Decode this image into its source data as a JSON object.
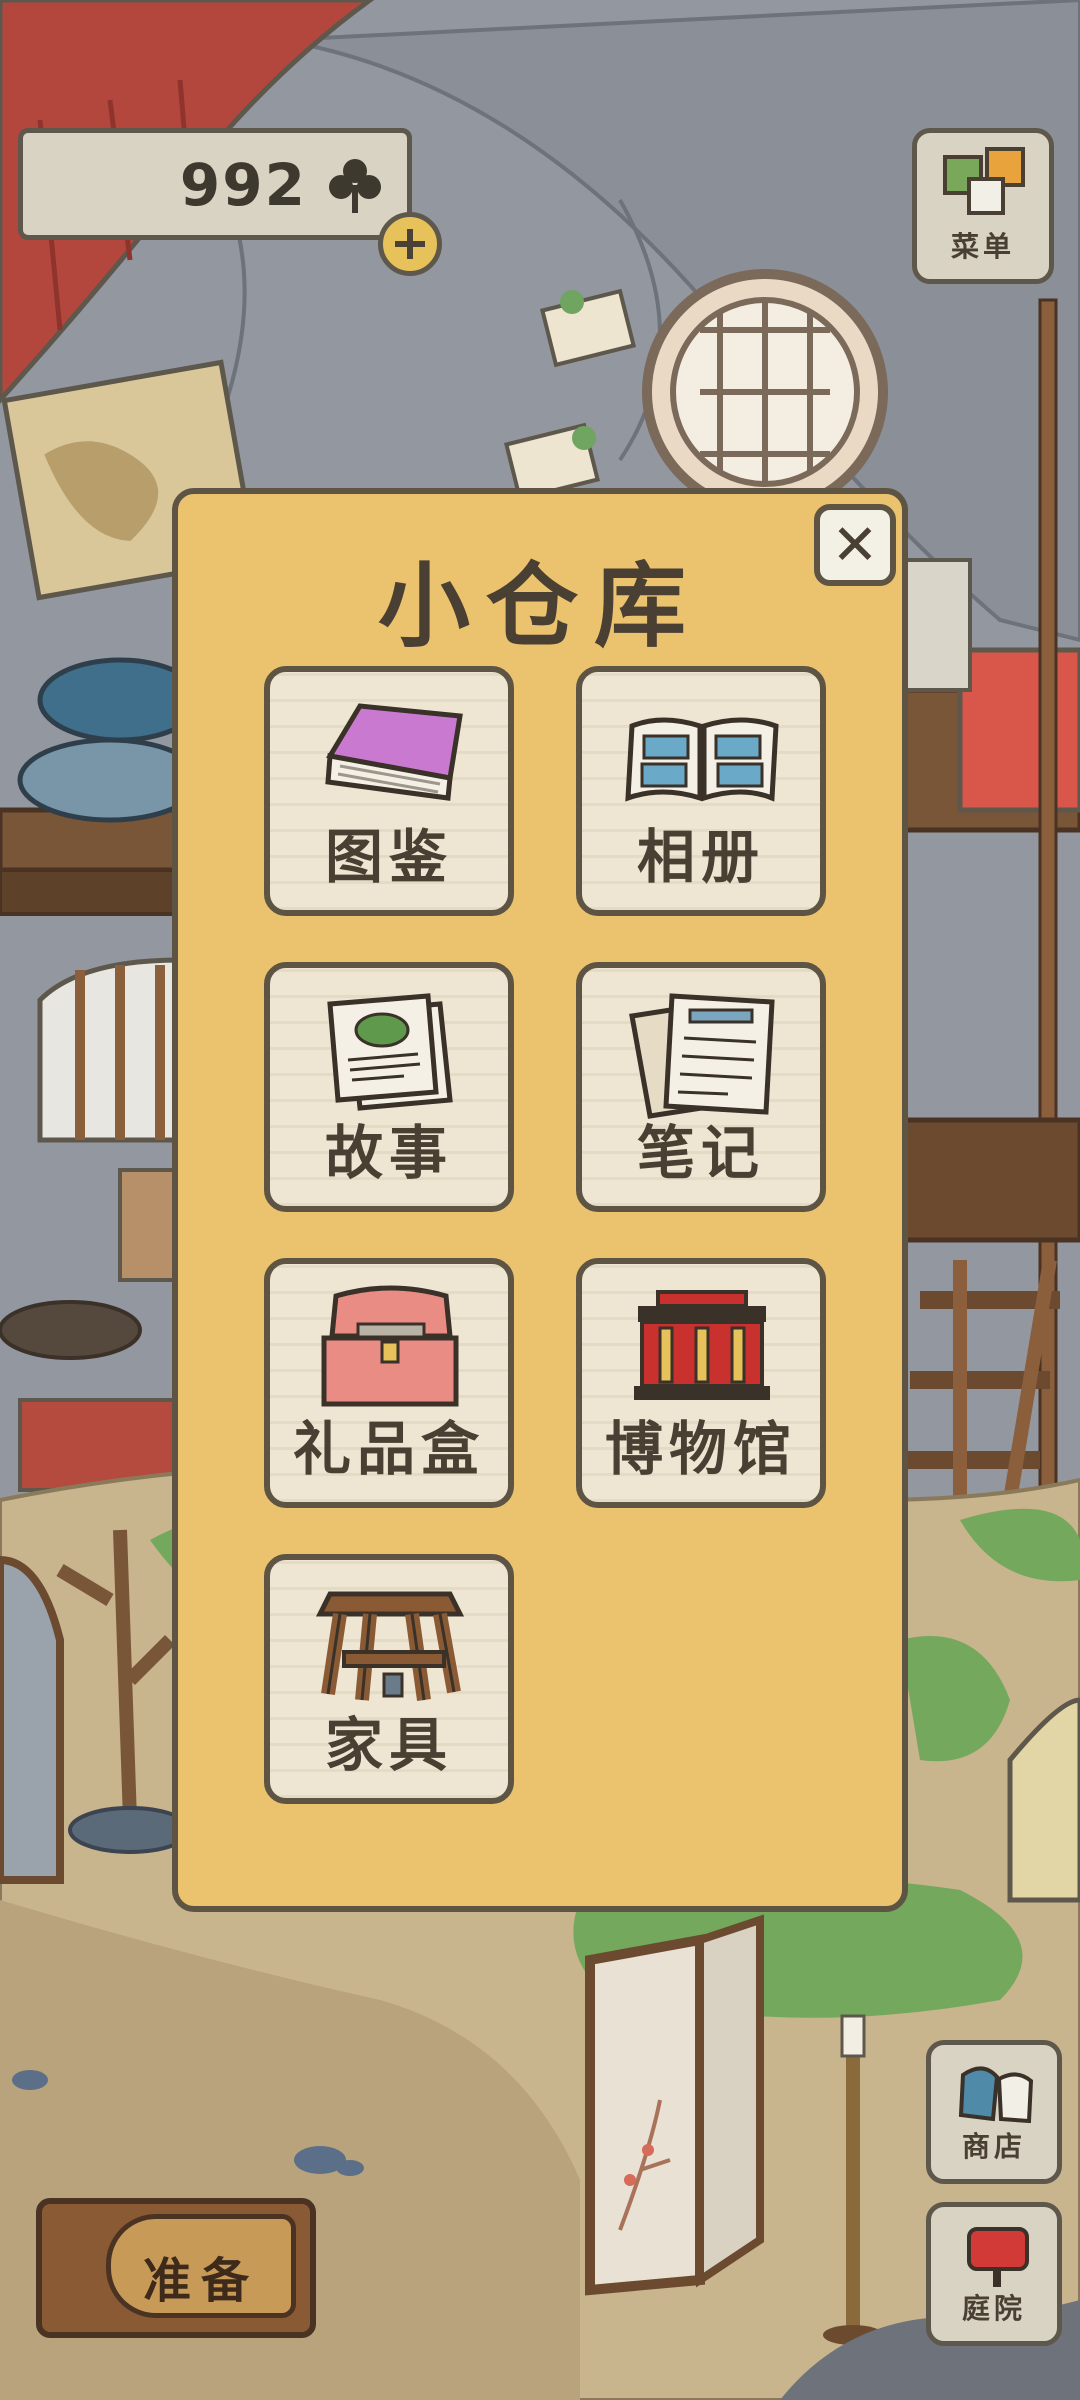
{
  "hud": {
    "clover_count": "992",
    "menu_label": "菜单",
    "shop_label": "商店",
    "yard_label": "庭院",
    "prepare_label": "准备"
  },
  "storage": {
    "title": "小仓库",
    "close_label": "✕",
    "items": [
      {
        "label": "图鉴",
        "icon": "book-icon"
      },
      {
        "label": "相册",
        "icon": "album-icon"
      },
      {
        "label": "故事",
        "icon": "story-card-icon"
      },
      {
        "label": "笔记",
        "icon": "notes-icon"
      },
      {
        "label": "礼品盒",
        "icon": "gift-box-icon"
      },
      {
        "label": "博物馆",
        "icon": "museum-icon"
      },
      {
        "label": "家具",
        "icon": "furniture-stool-icon"
      }
    ]
  },
  "colors": {
    "panel_bg": "#ebc36f",
    "tile_bg": "#eee6d2",
    "border": "#5d5444",
    "text": "#4a3f33",
    "book_purple": "#c97ad0",
    "album_blue": "#6aa9c8",
    "gift_pink": "#e98c84",
    "museum_red": "#c8312e"
  }
}
